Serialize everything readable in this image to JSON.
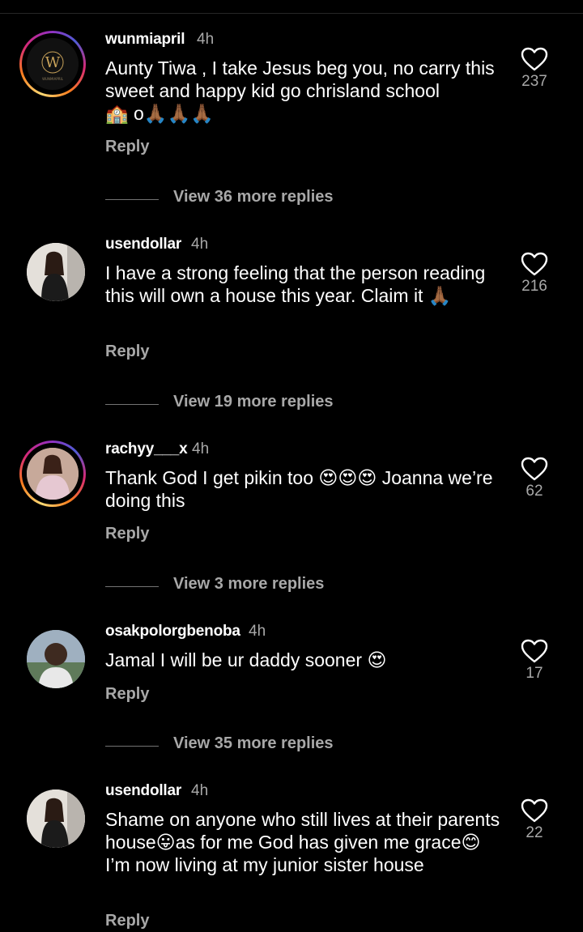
{
  "comments": [
    {
      "username": "wunmiapril",
      "time": "4h",
      "text": "Aunty Tiwa , I take Jesus beg you, no carry this sweet and happy kid go chrisland school",
      "emoji_tail": "🏫 o🙏🏾🙏🏾🙏🏾",
      "likes": "237",
      "reply_label": "Reply",
      "view_replies": "View 36 more replies",
      "avatar_logo_letter": "W",
      "avatar_logo_text": "WUNMIAPRIL"
    },
    {
      "username": "usendollar",
      "time": "4h",
      "text": "I have a strong feeling that the person reading this will own a house this year. Claim it 🙏🏾",
      "likes": "216",
      "reply_label": "Reply",
      "view_replies": "View 19 more replies"
    },
    {
      "username": "rachyy___x",
      "time": "4h",
      "text": "Thank God I get pikin too 😍😍😍 Joanna we’re doing this",
      "likes": "62",
      "reply_label": "Reply",
      "view_replies": "View 3 more replies"
    },
    {
      "username": "osakpolorgbenoba",
      "time": "4h",
      "text": "Jamal I will be ur daddy sooner 😍",
      "likes": "17",
      "reply_label": "Reply",
      "view_replies": "View 35 more replies"
    },
    {
      "username": "usendollar",
      "time": "4h",
      "text": "Shame on anyone who still lives at their parents house😛as for me God has given me grace😊 I’m now living at my junior sister house",
      "likes": "22",
      "reply_label": "Reply"
    }
  ]
}
